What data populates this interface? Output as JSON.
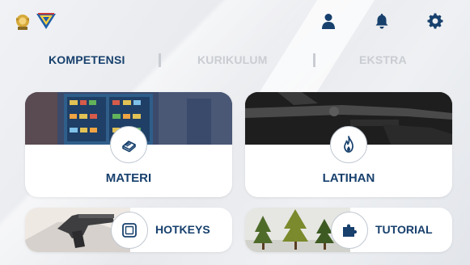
{
  "header": {
    "logos": [
      "emblem-logo",
      "shield-logo"
    ],
    "icons": [
      "user-icon",
      "bell-icon",
      "gear-icon"
    ]
  },
  "tabs": [
    {
      "label": "KOMPETENSI",
      "active": true
    },
    {
      "label": "KURIKULUM",
      "active": false
    },
    {
      "label": "EKSTRA",
      "active": false
    }
  ],
  "cards": {
    "materi": {
      "label": "MATERI",
      "icon": "book-icon"
    },
    "latihan": {
      "label": "LATIHAN",
      "icon": "flame-icon"
    },
    "hotkeys": {
      "label": "HOTKEYS",
      "icon": "square-icon"
    },
    "tutorial": {
      "label": "TUTORIAL",
      "icon": "puzzle-icon"
    }
  },
  "colors": {
    "primary": "#17406d",
    "inactive": "#c9ccd2",
    "background": "#e9ebee"
  }
}
